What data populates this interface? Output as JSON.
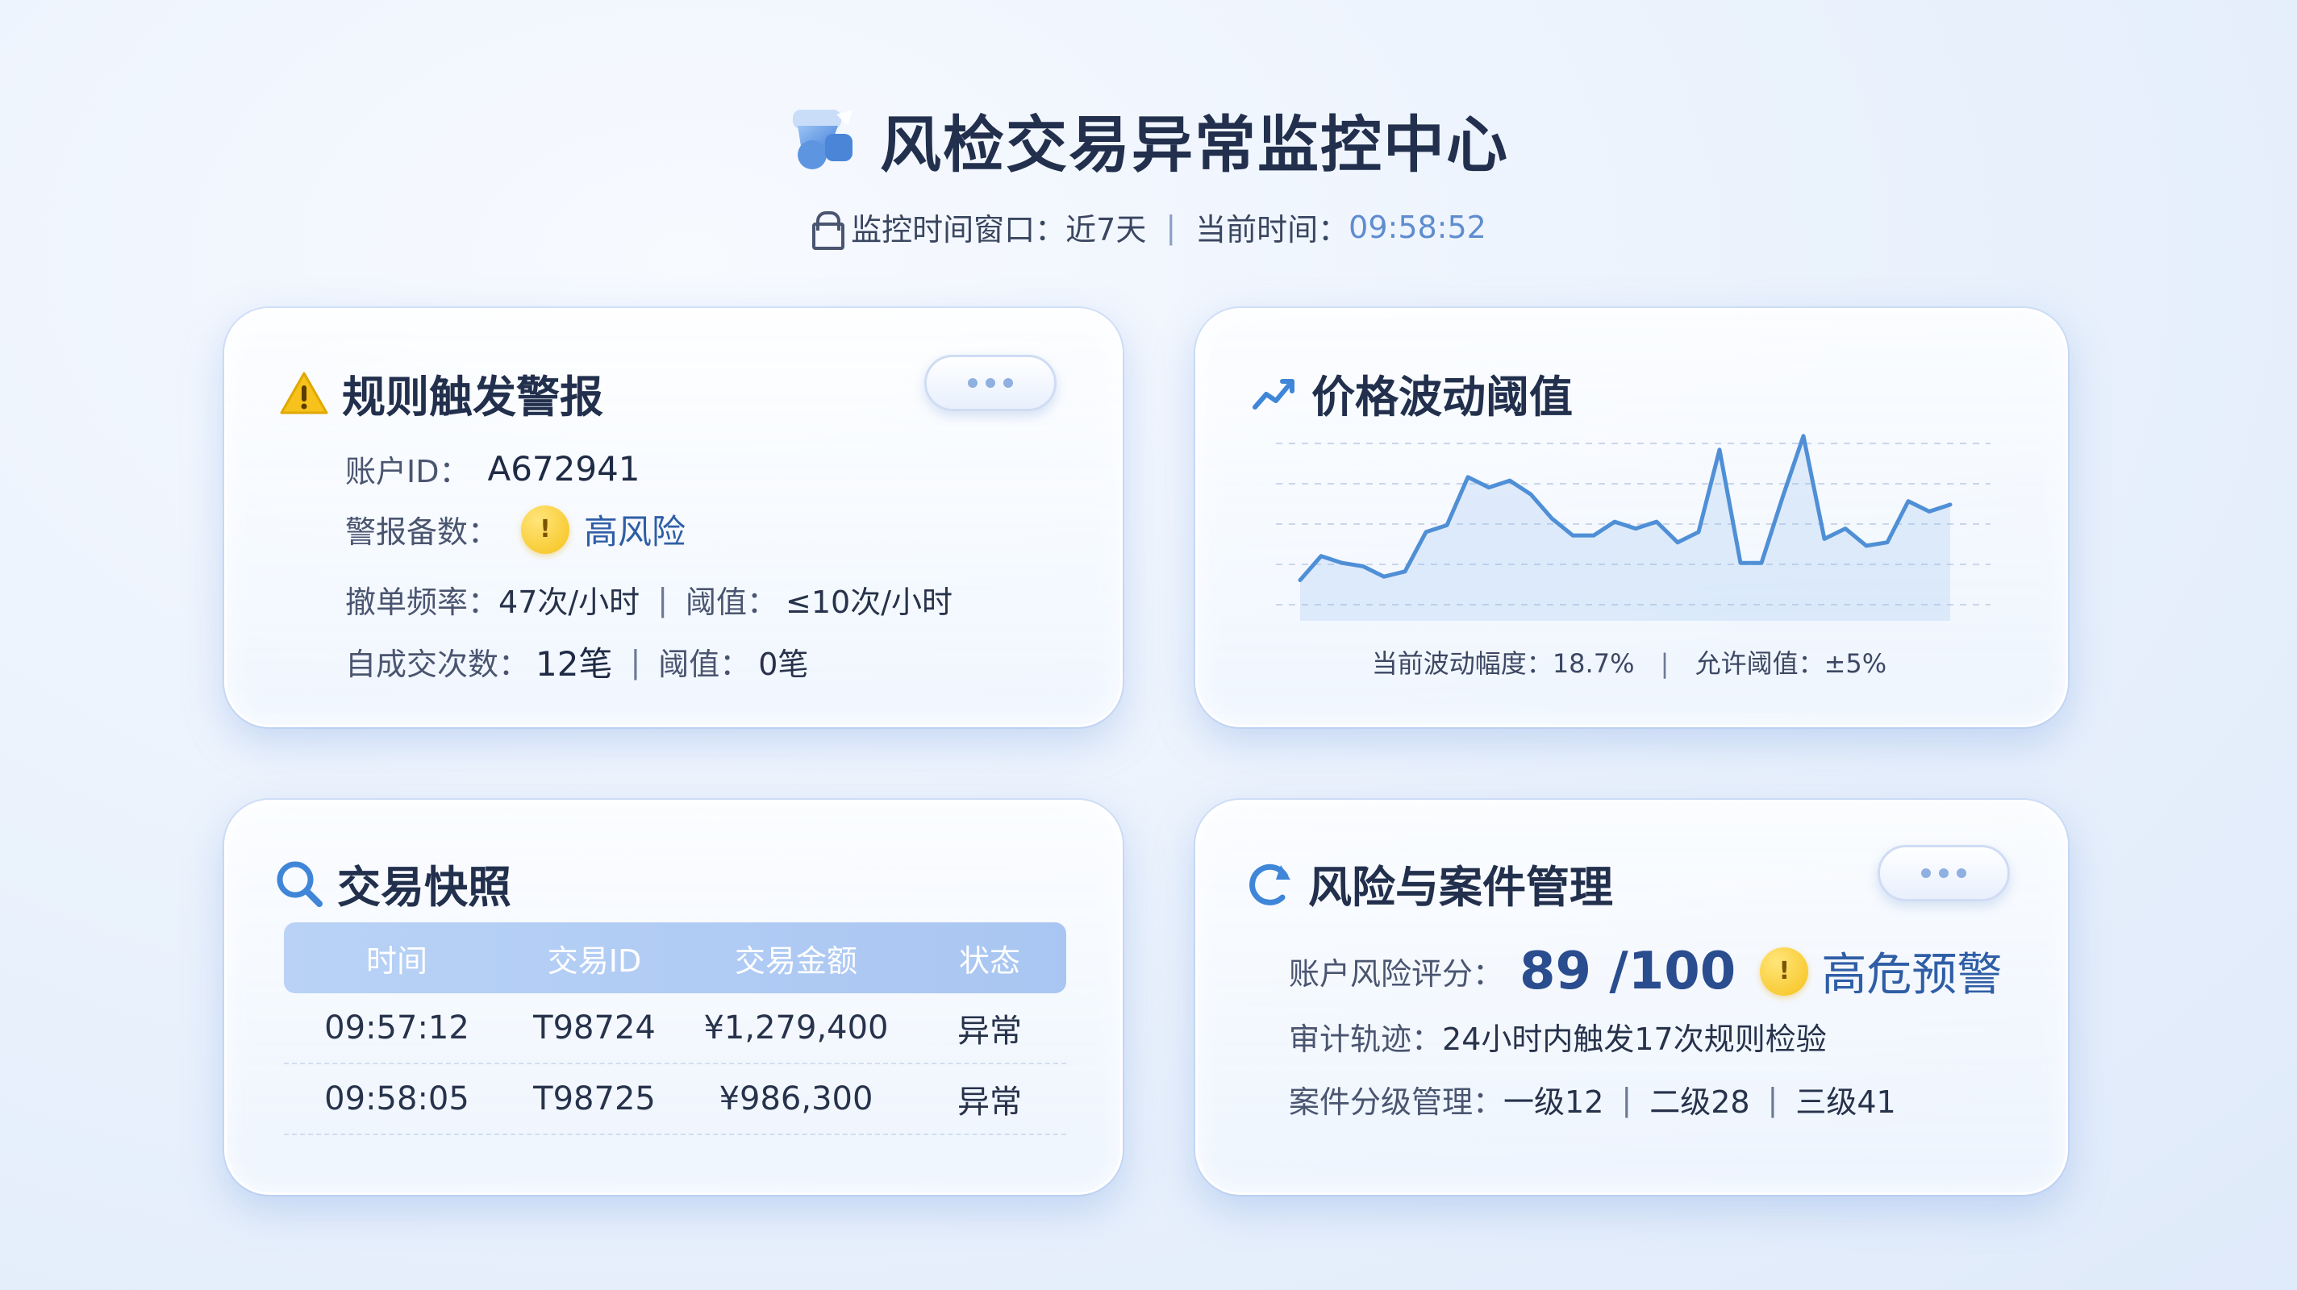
{
  "header": {
    "title": "风检交易异常监控中心",
    "window_label": "监控时间窗口：",
    "window_value": "近7天",
    "separator": "|",
    "time_label": "当前时间：",
    "time_value": "09:58:52"
  },
  "alerts": {
    "title": "规则触发警报",
    "account_label": "账户ID：",
    "account_value": "A672941",
    "alert_level_label": "警报备数：",
    "alert_level_value": "高风险",
    "cancel_label": "撤单频率：",
    "cancel_value": "47次/小时",
    "cancel_threshold_label": "阈值：",
    "cancel_threshold_value": "≤10次/小时",
    "self_trade_label": "自成交次数：",
    "self_trade_value": "12笔",
    "self_trade_threshold_label": "阈值：",
    "self_trade_threshold_value": "0笔"
  },
  "volatility": {
    "title": "价格波动阈值",
    "current_label": "当前波动幅度：",
    "current_value": "18.7%",
    "allowed_label": "允许阈值：",
    "allowed_value": "±5%"
  },
  "chart_data": {
    "type": "line",
    "title": "",
    "xlabel": "",
    "ylabel": "",
    "grid": true,
    "series": [
      {
        "values": [
          20,
          34,
          30,
          28,
          22,
          25,
          48,
          52,
          80,
          74,
          78,
          70,
          56,
          46,
          46,
          54,
          50,
          54,
          42,
          48,
          96,
          30,
          30,
          68,
          104,
          44,
          50,
          40,
          42,
          66,
          60,
          64
        ]
      }
    ],
    "color": "#4f8fd6"
  },
  "snapshot": {
    "title": "交易快照",
    "columns": [
      "时间",
      "交易ID",
      "交易金额",
      "状态"
    ],
    "rows": [
      [
        "09:57:12",
        "T98724",
        "¥1,279,400",
        "异常"
      ],
      [
        "09:58:05",
        "T98725",
        "¥986,300",
        "异常"
      ]
    ]
  },
  "case_mgmt": {
    "title": "风险与案件管理",
    "score_label": "账户风险评分：",
    "score_value": "89 /100",
    "warning_text": "高危预警",
    "audit_label": "审计轨迹：",
    "audit_value": "24小时内触发17次规则检验",
    "case_label": "案件分级管理：",
    "level1": "一级12",
    "level2": "二级28",
    "level3": "三级41"
  },
  "colors": {
    "accent": "#4f8fd6",
    "warning": "#f6c21b",
    "title": "#22304d"
  }
}
